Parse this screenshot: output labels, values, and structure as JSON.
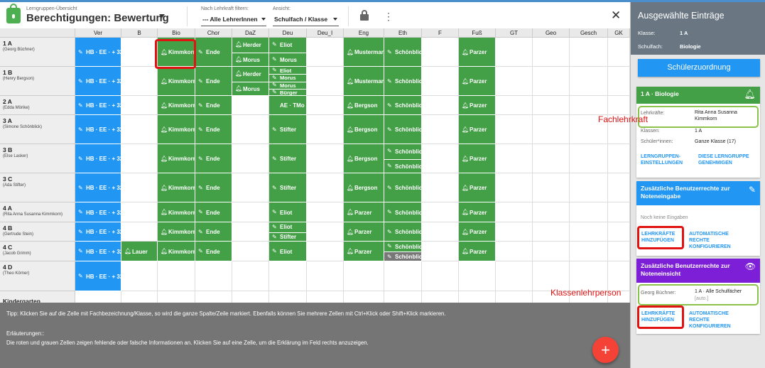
{
  "header": {
    "breadcrumb": "Lerngruppen-Übersicht",
    "title": "Berechtigungen: Bewertung",
    "filter_label": "Nach Lehrkraft filtern:",
    "filter_value": "--- Alle LehrerInnen",
    "view_label": "Ansicht:",
    "view_value": "Schulfach / Klasse"
  },
  "columns": [
    "Ver",
    "B",
    "Bio",
    "Chor",
    "DaZ",
    "Deu",
    "Deu_I",
    "Eng",
    "Eth",
    "F",
    "Fuß",
    "GT",
    "Geo",
    "Gesch",
    "GK"
  ],
  "rows": [
    {
      "name": "1 A",
      "teacher": "(Georg Büchner)"
    },
    {
      "name": "1 B",
      "teacher": "(Henry Bergson)"
    },
    {
      "name": "2 A",
      "teacher": "(Edda Mörike)"
    },
    {
      "name": "3 A",
      "teacher": "(Simone Schönblick)"
    },
    {
      "name": "3 B",
      "teacher": "(Else Lasker)"
    },
    {
      "name": "3 C",
      "teacher": "(Ada Stifter)"
    },
    {
      "name": "4 A",
      "teacher": "(Rita Anna Susanna Kimmkorn)"
    },
    {
      "name": "4 B",
      "teacher": "(Gertrude Stein)"
    },
    {
      "name": "4 C",
      "teacher": "(Jacob Grimm)"
    },
    {
      "name": "4 D",
      "teacher": "(Theo Körner)"
    },
    {
      "name": "Kindergarten",
      "teacher": ""
    }
  ],
  "cells": [
    {
      "r": 0,
      "c": 0,
      "color": "blue",
      "icon": "pencil",
      "entries": [
        "HB · EE · + 32"
      ]
    },
    {
      "r": 0,
      "c": 2,
      "color": "green",
      "icon": "bell",
      "entries": [
        "Kimmkorn"
      ]
    },
    {
      "r": 0,
      "c": 3,
      "color": "green",
      "icon": "pencil",
      "entries": [
        "Ende"
      ]
    },
    {
      "r": 0,
      "c": 4,
      "color": "green",
      "icon": "bell",
      "entries": [
        "Herder",
        "Morus"
      ]
    },
    {
      "r": 0,
      "c": 5,
      "color": "green",
      "icon": "pencil",
      "entries": [
        "Eliot",
        "Morus"
      ]
    },
    {
      "r": 0,
      "c": 7,
      "color": "green",
      "icon": "bell",
      "entries": [
        "Mustermann"
      ]
    },
    {
      "r": 0,
      "c": 8,
      "color": "green",
      "icon": "pencil",
      "entries": [
        "Schönblick"
      ]
    },
    {
      "r": 0,
      "c": 10,
      "color": "green",
      "icon": "bell",
      "entries": [
        "Parzer"
      ]
    },
    {
      "r": 1,
      "c": 0,
      "color": "blue",
      "icon": "pencil",
      "entries": [
        "HB · EE · + 32"
      ]
    },
    {
      "r": 1,
      "c": 2,
      "color": "green",
      "icon": "bell",
      "entries": [
        "Kimmkorn"
      ]
    },
    {
      "r": 1,
      "c": 3,
      "color": "green",
      "icon": "pencil",
      "entries": [
        "Ende"
      ]
    },
    {
      "r": 1,
      "c": 4,
      "color": "green",
      "icon": "bell",
      "entries": [
        "Herder",
        "Morus"
      ]
    },
    {
      "r": 1,
      "c": 5,
      "color": "green",
      "icon": "pencil",
      "entries": [
        "Eliot",
        "Morus",
        "Morus",
        "Bürger"
      ]
    },
    {
      "r": 1,
      "c": 7,
      "color": "green",
      "icon": "bell",
      "entries": [
        "Mustermann"
      ]
    },
    {
      "r": 1,
      "c": 8,
      "color": "green",
      "icon": "pencil",
      "entries": [
        "Schönblick"
      ]
    },
    {
      "r": 1,
      "c": 10,
      "color": "green",
      "icon": "bell",
      "entries": [
        "Parzer"
      ]
    },
    {
      "r": 2,
      "c": 0,
      "color": "blue",
      "icon": "pencil",
      "entries": [
        "HB · EE · + 32"
      ]
    },
    {
      "r": 2,
      "c": 2,
      "color": "green",
      "icon": "bell",
      "entries": [
        "Kimmkorn"
      ]
    },
    {
      "r": 2,
      "c": 3,
      "color": "green",
      "icon": "pencil",
      "entries": [
        "Ende"
      ]
    },
    {
      "r": 2,
      "c": 5,
      "color": "green",
      "icon": "none",
      "entries": [
        "AE · TMo"
      ]
    },
    {
      "r": 2,
      "c": 7,
      "color": "green",
      "icon": "bell",
      "entries": [
        "Bergson"
      ]
    },
    {
      "r": 2,
      "c": 8,
      "color": "green",
      "icon": "pencil",
      "entries": [
        "Schönblick"
      ]
    },
    {
      "r": 2,
      "c": 10,
      "color": "green",
      "icon": "bell",
      "entries": [
        "Parzer"
      ]
    },
    {
      "r": 3,
      "c": 0,
      "color": "blue",
      "icon": "pencil",
      "entries": [
        "HB · EE · + 32"
      ]
    },
    {
      "r": 3,
      "c": 2,
      "color": "green",
      "icon": "bell",
      "entries": [
        "Kimmkorn"
      ]
    },
    {
      "r": 3,
      "c": 3,
      "color": "green",
      "icon": "pencil",
      "entries": [
        "Ende"
      ]
    },
    {
      "r": 3,
      "c": 5,
      "color": "green",
      "icon": "pencil",
      "entries": [
        "Stifter"
      ]
    },
    {
      "r": 3,
      "c": 7,
      "color": "green",
      "icon": "bell",
      "entries": [
        "Bergson"
      ]
    },
    {
      "r": 3,
      "c": 8,
      "color": "green",
      "icon": "pencil",
      "entries": [
        "Schönblick"
      ]
    },
    {
      "r": 3,
      "c": 10,
      "color": "green",
      "icon": "bell",
      "entries": [
        "Parzer"
      ]
    },
    {
      "r": 4,
      "c": 0,
      "color": "blue",
      "icon": "pencil",
      "entries": [
        "HB · EE · + 32"
      ]
    },
    {
      "r": 4,
      "c": 2,
      "color": "green",
      "icon": "bell",
      "entries": [
        "Kimmkorn"
      ]
    },
    {
      "r": 4,
      "c": 3,
      "color": "green",
      "icon": "pencil",
      "entries": [
        "Ende"
      ]
    },
    {
      "r": 4,
      "c": 5,
      "color": "green",
      "icon": "pencil",
      "entries": [
        "Stifter"
      ]
    },
    {
      "r": 4,
      "c": 7,
      "color": "green",
      "icon": "bell",
      "entries": [
        "Bergson"
      ]
    },
    {
      "r": 4,
      "c": 8,
      "color": "green",
      "icon": "pencil",
      "entries": [
        "Schönblick",
        "Schönblick"
      ]
    },
    {
      "r": 4,
      "c": 10,
      "color": "green",
      "icon": "bell",
      "entries": [
        "Parzer"
      ]
    },
    {
      "r": 5,
      "c": 0,
      "color": "blue",
      "icon": "pencil",
      "entries": [
        "HB · EE · + 32"
      ]
    },
    {
      "r": 5,
      "c": 2,
      "color": "green",
      "icon": "bell",
      "entries": [
        "Kimmkorn"
      ]
    },
    {
      "r": 5,
      "c": 3,
      "color": "green",
      "icon": "pencil",
      "entries": [
        "Ende"
      ]
    },
    {
      "r": 5,
      "c": 5,
      "color": "green",
      "icon": "pencil",
      "entries": [
        "Stifter"
      ]
    },
    {
      "r": 5,
      "c": 7,
      "color": "green",
      "icon": "bell",
      "entries": [
        "Bergson"
      ]
    },
    {
      "r": 5,
      "c": 8,
      "color": "green",
      "icon": "pencil",
      "entries": [
        "Schönblick"
      ]
    },
    {
      "r": 5,
      "c": 10,
      "color": "green",
      "icon": "bell",
      "entries": [
        "Parzer"
      ]
    },
    {
      "r": 6,
      "c": 0,
      "color": "blue",
      "icon": "pencil",
      "entries": [
        "HB · EE · + 32"
      ]
    },
    {
      "r": 6,
      "c": 2,
      "color": "green",
      "icon": "bell",
      "entries": [
        "Kimmkorn"
      ]
    },
    {
      "r": 6,
      "c": 3,
      "color": "green",
      "icon": "pencil",
      "entries": [
        "Ende"
      ]
    },
    {
      "r": 6,
      "c": 5,
      "color": "green",
      "icon": "pencil",
      "entries": [
        "Eliot"
      ]
    },
    {
      "r": 6,
      "c": 7,
      "color": "green",
      "icon": "bell",
      "entries": [
        "Parzer"
      ]
    },
    {
      "r": 6,
      "c": 8,
      "color": "green",
      "icon": "pencil",
      "entries": [
        "Schönblick"
      ]
    },
    {
      "r": 6,
      "c": 10,
      "color": "green",
      "icon": "bell",
      "entries": [
        "Parzer"
      ]
    },
    {
      "r": 7,
      "c": 0,
      "color": "blue",
      "icon": "pencil",
      "entries": [
        "HB · EE · + 32"
      ]
    },
    {
      "r": 7,
      "c": 2,
      "color": "green",
      "icon": "bell",
      "entries": [
        "Kimmkorn"
      ]
    },
    {
      "r": 7,
      "c": 3,
      "color": "green",
      "icon": "pencil",
      "entries": [
        "Ende"
      ]
    },
    {
      "r": 7,
      "c": 5,
      "color": "green",
      "icon": "pencil",
      "entries": [
        "Eliot",
        "Stifter"
      ]
    },
    {
      "r": 7,
      "c": 7,
      "color": "green",
      "icon": "bell",
      "entries": [
        "Parzer"
      ]
    },
    {
      "r": 7,
      "c": 8,
      "color": "green",
      "icon": "pencil",
      "entries": [
        "Schönblick"
      ]
    },
    {
      "r": 7,
      "c": 10,
      "color": "green",
      "icon": "bell",
      "entries": [
        "Parzer"
      ]
    },
    {
      "r": 8,
      "c": 0,
      "color": "blue",
      "icon": "pencil",
      "entries": [
        "HB · EE · + 32"
      ]
    },
    {
      "r": 8,
      "c": 1,
      "color": "green",
      "icon": "bell",
      "entries": [
        "Lauer"
      ]
    },
    {
      "r": 8,
      "c": 2,
      "color": "green",
      "icon": "bell",
      "entries": [
        "Kimmkorn"
      ]
    },
    {
      "r": 8,
      "c": 3,
      "color": "green",
      "icon": "pencil",
      "entries": [
        "Ende"
      ]
    },
    {
      "r": 8,
      "c": 5,
      "color": "green",
      "icon": "pencil",
      "entries": [
        "Eliot"
      ]
    },
    {
      "r": 8,
      "c": 7,
      "color": "green",
      "icon": "bell",
      "entries": [
        "Parzer"
      ]
    },
    {
      "r": 8,
      "c": 8,
      "color": "green",
      "icon": "pencil",
      "entries": [
        "Schönblick",
        "Schönblick"
      ],
      "greySecond": true
    },
    {
      "r": 8,
      "c": 10,
      "color": "green",
      "icon": "bell",
      "entries": [
        "Parzer"
      ]
    },
    {
      "r": 9,
      "c": 0,
      "color": "blue",
      "icon": "pencil",
      "entries": [
        "HB · EE · + 32"
      ]
    }
  ],
  "tip": {
    "text": "Tipp: Klicken Sie auf die Zelle mit Fachbezeichnung/Klasse, so wird die ganze Spalte/Zeile markiert. Ebenfalls können Sie mehrere Zellen mit Ctrl+Klick oder Shift+Klick markieren.",
    "expl_title": "Erläuterungen::",
    "expl_text": "Die roten und grauen Zellen zeigen fehlende oder falsche Informationen an. Klicken Sie auf eine Zelle, um die Erklärung im Feld rechts anzuzeigen."
  },
  "fab_label": "+",
  "panel": {
    "title": "Ausgewählte Einträge",
    "klasse_label": "Klasse:",
    "klasse_value": "1 A",
    "schulfach_label": "Schulfach:",
    "schulfach_value": "Biologie",
    "assign_button": "Schülerzuordnung",
    "group_card": {
      "title": "1 A · Biologie",
      "teachers_label": "Lehrkräfte:",
      "teachers_value": "Rita Anna Susanna Kimmkorn",
      "classes_label": "Klassen:",
      "classes_value": "1 A",
      "students_label": "Schüler*innen:",
      "students_value": "Ganze Klasse (17)",
      "link_settings": "LERNGRUPPEN-EINSTELLUNGEN",
      "link_approve": "DIESE LERNGRUPPE GENEHMIGEN"
    },
    "entry_card": {
      "title": "Zusätzliche Benutzerrechte zur Noteneingabe",
      "empty_text": "Noch keine Eingaben",
      "add_link": "LEHRKRÄFTE HINZUFÜGEN",
      "auto_link": "AUTOMATISCHE RECHTE KONFIGURIEREN"
    },
    "view_card": {
      "title": "Zusätzliche Benutzerrechte zur Noteneinsicht",
      "person": "Georg Büchner:",
      "scope": "1 A · Alle Schulfächer",
      "auto_tag": "[auto.]",
      "add_link": "LEHRKRÄFTE HINZUFÜGEN",
      "auto_link": "AUTOMATISCHE RECHTE KONFIGURIEREN"
    }
  },
  "annotations": {
    "fachlehrkraft": "Fachlehrkraft",
    "klassenlehrperson": "Klassenlehrperson"
  },
  "colors": {
    "blue": "#2196f3",
    "green": "#43a047",
    "grey": "#777777",
    "accent_red": "#e01212",
    "purple": "#7c1fd6"
  }
}
